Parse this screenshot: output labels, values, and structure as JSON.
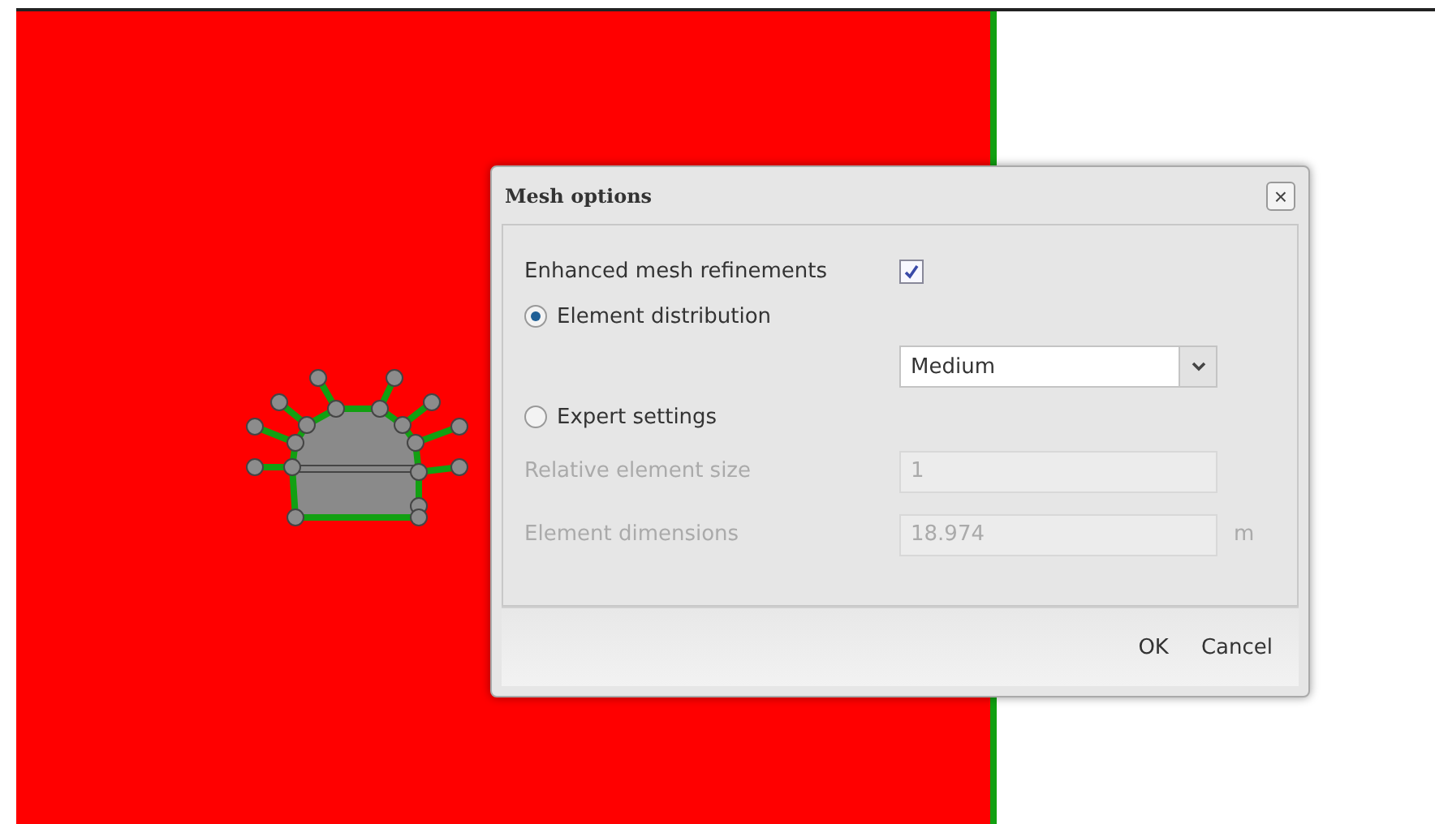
{
  "dialog": {
    "title": "Mesh options",
    "close": "×",
    "rows": [
      {
        "kind": "checkbox",
        "label": "Enhanced mesh refinements",
        "checked": true
      },
      {
        "kind": "radio",
        "label": "Element distribution",
        "selected": true
      },
      {
        "kind": "select",
        "value": "Medium"
      },
      {
        "kind": "radio",
        "label": "Expert settings",
        "selected": false
      },
      {
        "kind": "text",
        "label": "Relative element size",
        "value": "1",
        "disabled": true
      },
      {
        "kind": "text",
        "label": "Element dimensions",
        "value": "18.974",
        "unit": "m",
        "disabled": true
      }
    ],
    "buttons": [
      "OK",
      "Cancel"
    ]
  }
}
